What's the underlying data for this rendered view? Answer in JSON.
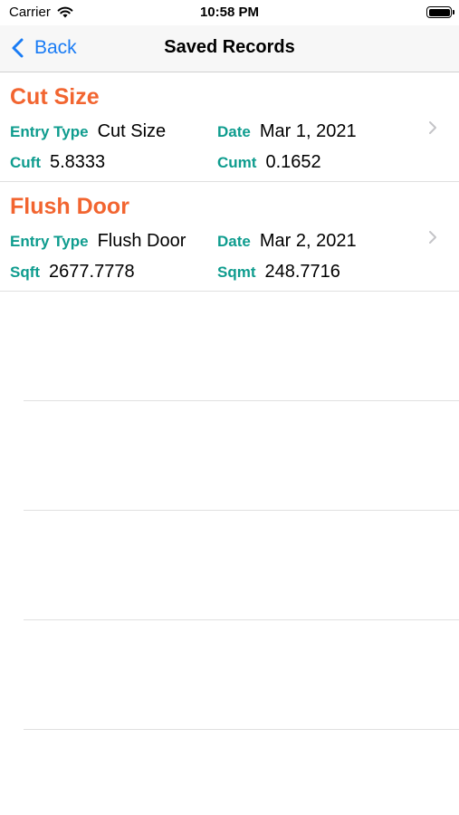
{
  "status": {
    "carrier": "Carrier",
    "time": "10:58 PM"
  },
  "nav": {
    "back_label": "Back",
    "title": "Saved Records"
  },
  "records": [
    {
      "title": "Cut Size",
      "entry_type_label": "Entry Type",
      "entry_type": "Cut Size",
      "date_label": "Date",
      "date": "Mar 1, 2021",
      "m1_label": "Cuft",
      "m1": "5.8333",
      "m2_label": "Cumt",
      "m2": "0.1652"
    },
    {
      "title": "Flush Door",
      "entry_type_label": "Entry Type",
      "entry_type": "Flush Door",
      "date_label": "Date",
      "date": "Mar 2, 2021",
      "m1_label": "Sqft",
      "m1": "2677.7778",
      "m2_label": "Sqmt",
      "m2": "248.7716"
    }
  ],
  "colors": {
    "accent": "#1a7cf5",
    "title": "#f26530",
    "label": "#0e9c8e"
  }
}
